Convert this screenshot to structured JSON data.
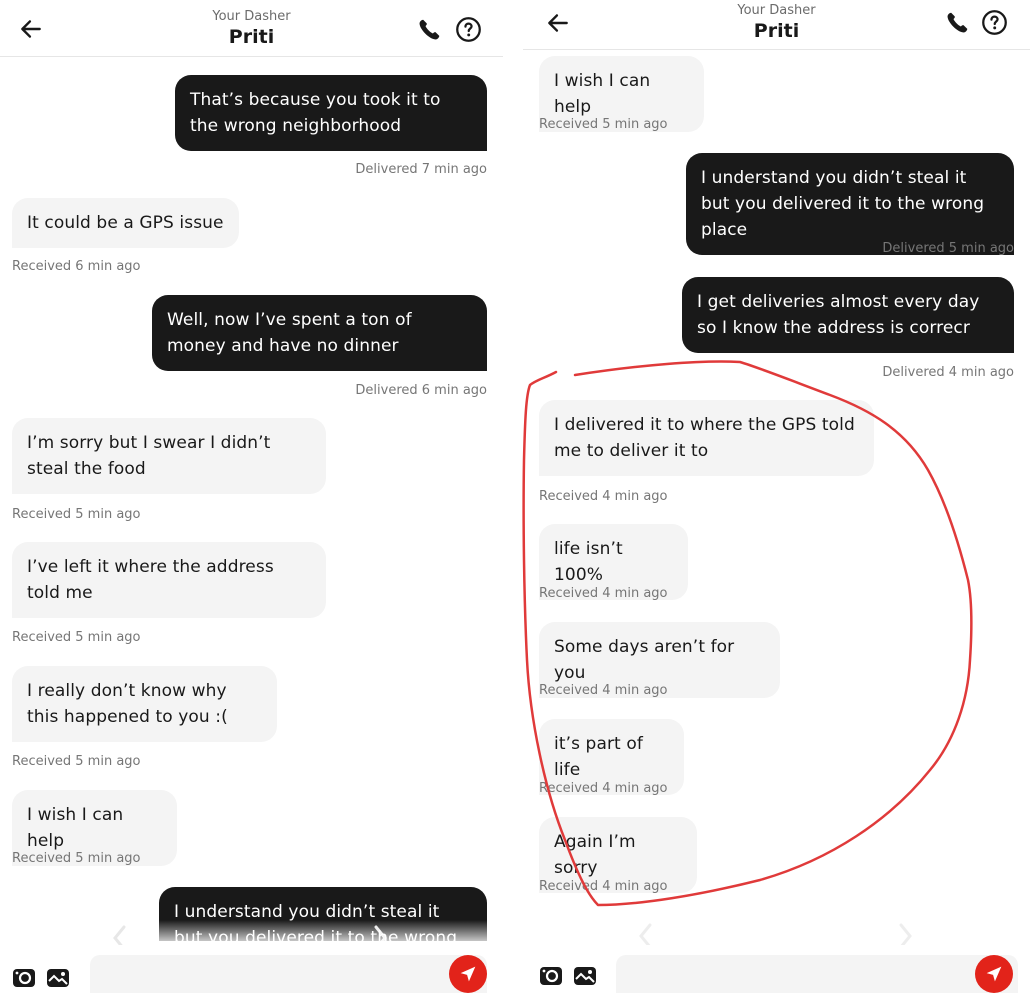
{
  "header": {
    "subtitle": "Your Dasher",
    "title": "Priti"
  },
  "icons": {
    "back": "arrow-left-icon",
    "call": "phone-icon",
    "help": "question-circle-icon",
    "camera": "camera-icon",
    "gallery": "image-icon",
    "send": "send-icon"
  },
  "colors": {
    "accent": "#e2231a",
    "sent_bubble": "#191919",
    "received_bubble": "#f4f4f4",
    "annotation": "#e03a3a"
  },
  "composer": {
    "placeholder": "",
    "value": ""
  },
  "left_panel": {
    "messages": [
      {
        "direction": "out",
        "text": "That’s because you took it to the wrong neighborhood",
        "status": "Delivered 7 min ago"
      },
      {
        "direction": "in",
        "text": "It could be a GPS issue",
        "status": "Received 6 min ago"
      },
      {
        "direction": "out",
        "text": "Well, now I’ve spent a ton of money and have no dinner",
        "status": "Delivered 6 min ago"
      },
      {
        "direction": "in",
        "text": "I’m sorry but I swear I didn’t steal the food",
        "status": "Received 5 min ago"
      },
      {
        "direction": "in",
        "text": "I’ve left it where the address told me",
        "status": "Received 5 min ago"
      },
      {
        "direction": "in",
        "text": "I really don’t know why this happened to you :(",
        "status": "Received 5 min ago"
      },
      {
        "direction": "in",
        "text": "I wish I can help",
        "status": "Received 5 min ago"
      },
      {
        "direction": "out",
        "text": "I understand you didn’t steal it but you delivered it to the wrong place",
        "status": ""
      }
    ]
  },
  "right_panel": {
    "messages": [
      {
        "direction": "in",
        "text": "I wish I can help",
        "status": "Received 5 min ago"
      },
      {
        "direction": "out",
        "text": "I understand you didn’t steal it but you delivered it to the wrong place",
        "status": "Delivered 5 min ago"
      },
      {
        "direction": "out",
        "text": "I get deliveries almost every day so I know the address is correcr",
        "status": "Delivered 4 min ago"
      },
      {
        "direction": "in",
        "text": "I delivered it to where the GPS told me to deliver it to",
        "status": "Received 4 min ago"
      },
      {
        "direction": "in",
        "text": "life isn’t 100%",
        "status": "Received 4 min ago"
      },
      {
        "direction": "in",
        "text": "Some days aren’t for you",
        "status": "Received 4 min ago"
      },
      {
        "direction": "in",
        "text": "it’s part of life",
        "status": "Received 4 min ago"
      },
      {
        "direction": "in",
        "text": "Again I’m sorry",
        "status": "Received 4 min ago"
      }
    ]
  }
}
